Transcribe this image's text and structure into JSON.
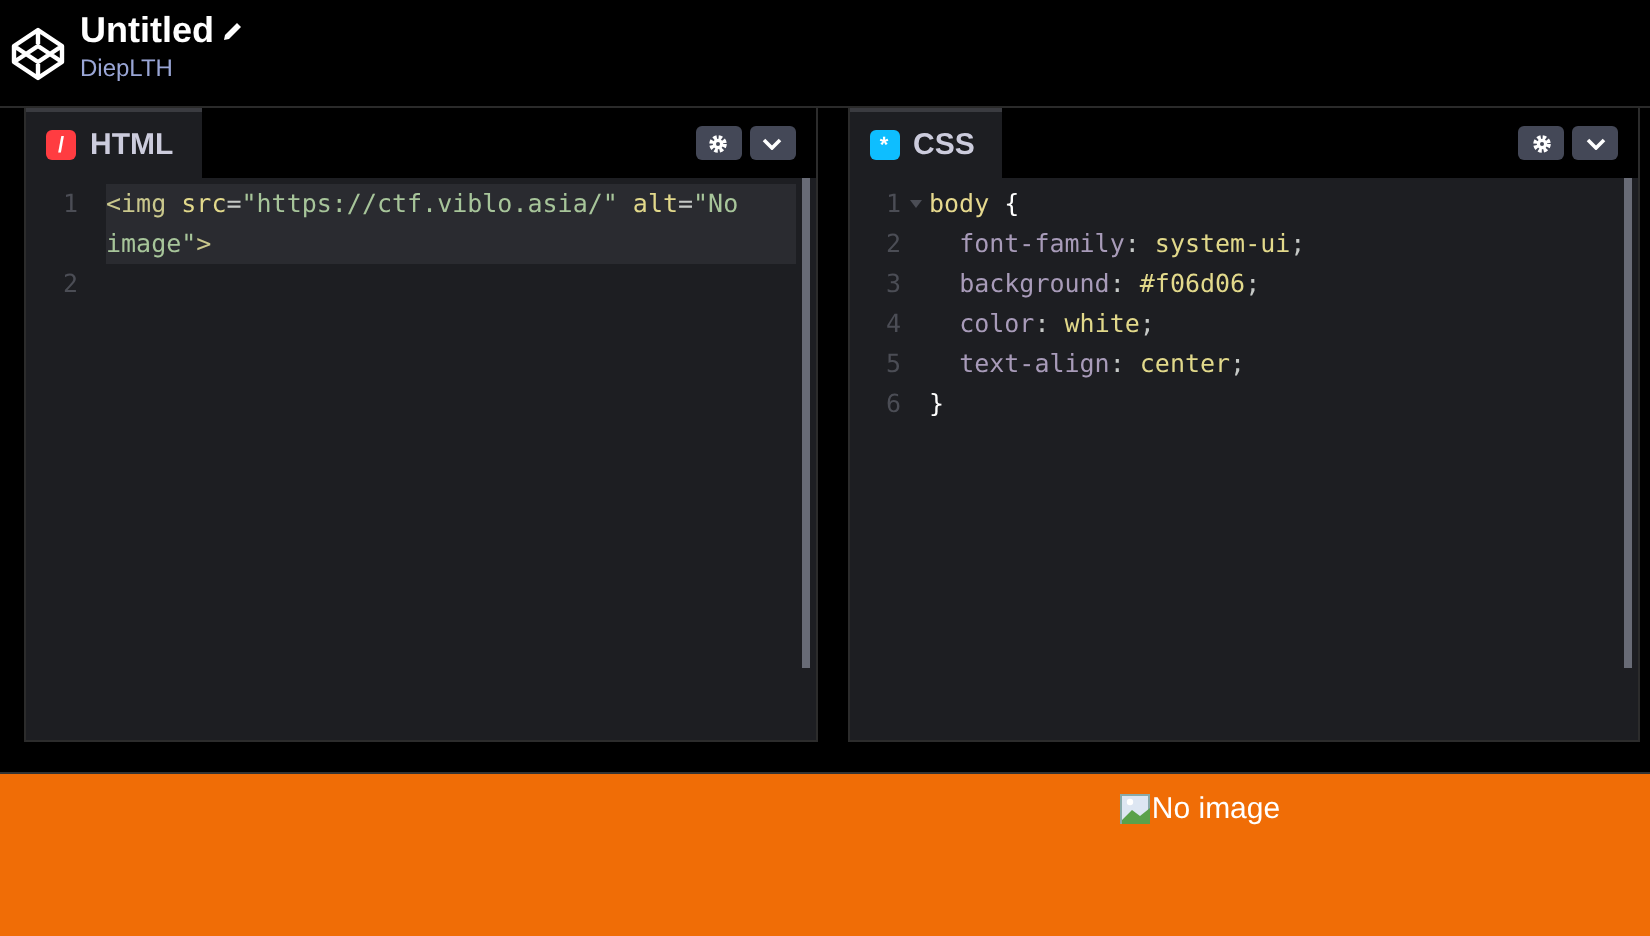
{
  "header": {
    "title": "Untitled",
    "author": "DiepLTH"
  },
  "editors": [
    {
      "kind": "html",
      "badge": "/",
      "title": "HTML",
      "lines": [
        {
          "number": "1",
          "highlighted": true,
          "foldable": false,
          "tokens": [
            {
              "text": "<img ",
              "kind": "tag"
            },
            {
              "text": "src",
              "kind": "attr"
            },
            {
              "text": "=",
              "kind": "punct"
            },
            {
              "text": "\"https://ctf.viblo.asia/\" ",
              "kind": "string"
            },
            {
              "text": "alt",
              "kind": "attr"
            },
            {
              "text": "=",
              "kind": "punct"
            },
            {
              "text": "\"No image\"",
              "kind": "string"
            },
            {
              "text": ">",
              "kind": "tag"
            }
          ]
        },
        {
          "number": "2",
          "highlighted": false,
          "foldable": false
        }
      ]
    },
    {
      "kind": "css",
      "badge": "*",
      "title": "CSS",
      "lines": [
        {
          "number": "1",
          "highlighted": false,
          "foldable": true,
          "tokens": [
            {
              "text": "body",
              "kind": "selector"
            },
            {
              "text": " {",
              "kind": "brace"
            }
          ]
        },
        {
          "number": "2",
          "highlighted": false,
          "foldable": false,
          "tokens": [
            {
              "text": "  font-family",
              "kind": "property"
            },
            {
              "text": ": ",
              "kind": "punct"
            },
            {
              "text": "system-ui",
              "kind": "value"
            },
            {
              "text": ";",
              "kind": "punct"
            }
          ]
        },
        {
          "number": "3",
          "highlighted": false,
          "foldable": false,
          "tokens": [
            {
              "text": "  background",
              "kind": "property"
            },
            {
              "text": ": ",
              "kind": "punct"
            },
            {
              "text": "#f06d06",
              "kind": "value"
            },
            {
              "text": ";",
              "kind": "punct"
            }
          ]
        },
        {
          "number": "4",
          "highlighted": false,
          "foldable": false,
          "tokens": [
            {
              "text": "  color",
              "kind": "property"
            },
            {
              "text": ": ",
              "kind": "punct"
            },
            {
              "text": "white",
              "kind": "value"
            },
            {
              "text": ";",
              "kind": "punct"
            }
          ]
        },
        {
          "number": "5",
          "highlighted": false,
          "foldable": false,
          "tokens": [
            {
              "text": "  text-align",
              "kind": "property"
            },
            {
              "text": ": ",
              "kind": "punct"
            },
            {
              "text": "center",
              "kind": "value"
            },
            {
              "text": ";",
              "kind": "punct"
            }
          ]
        },
        {
          "number": "6",
          "highlighted": false,
          "foldable": false,
          "tokens": [
            {
              "text": "}",
              "kind": "brace"
            }
          ]
        }
      ]
    }
  ],
  "preview": {
    "image_alt": "No image"
  }
}
